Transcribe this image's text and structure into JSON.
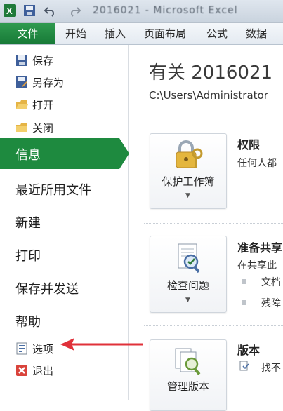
{
  "titlebar": {
    "title": "2016021 - Microsoft Excel",
    "icons": [
      "excel-app-icon",
      "save-icon",
      "undo-icon",
      "redo-icon"
    ]
  },
  "ribbon": {
    "file_tab": "文件",
    "tabs": [
      "开始",
      "插入",
      "页面布局",
      "公式",
      "数据"
    ]
  },
  "sidebar": {
    "small_items": [
      {
        "label": "保存",
        "icon": "save-icon"
      },
      {
        "label": "另存为",
        "icon": "save-as-icon"
      },
      {
        "label": "打开",
        "icon": "open-folder-icon"
      },
      {
        "label": "关闭",
        "icon": "close-folder-icon"
      }
    ],
    "info": "信息",
    "big_items": [
      "最近所用文件",
      "新建",
      "打印",
      "保存并发送",
      "帮助"
    ],
    "options": {
      "label": "选项",
      "icon": "options-icon"
    },
    "exit": {
      "label": "退出",
      "icon": "exit-icon"
    }
  },
  "main": {
    "title": "有关 2016021",
    "path": "C:\\Users\\Administrator",
    "sections": [
      {
        "button": "保护工作簿",
        "heading": "权限",
        "text": "任何人都",
        "icon": "lock-key-icon"
      },
      {
        "button": "检查问题",
        "heading": "准备共享",
        "text": "在共享此",
        "bullets": [
          "文档",
          "残障"
        ],
        "icon": "inspect-document-icon"
      },
      {
        "button": "管理版本",
        "heading": "版本",
        "text": "找不",
        "icon": "manage-versions-icon"
      }
    ]
  },
  "colors": {
    "accent": "#1e8a3f",
    "annotation": "#e0313a"
  }
}
